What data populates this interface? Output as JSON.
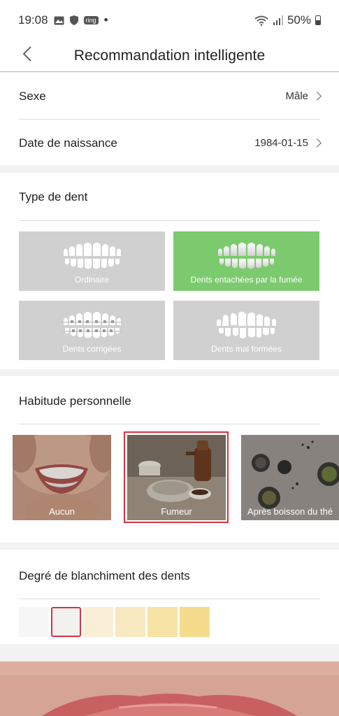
{
  "status_bar": {
    "time": "19:08",
    "ring_label": "ring",
    "dot": "•",
    "battery": "50%"
  },
  "header": {
    "title": "Recommandation intelligente"
  },
  "profile": {
    "sex_label": "Sexe",
    "sex_value": "Mâle",
    "birth_label": "Date de naissance",
    "birth_value": "1984-01-15"
  },
  "tooth_type": {
    "title": "Type de dent",
    "options": [
      {
        "label": "Ordinaire",
        "selected": false
      },
      {
        "label": "Dents entachées par la fumée",
        "selected": true
      },
      {
        "label": "Dents corrigées",
        "selected": false
      },
      {
        "label": "Dents mal formées",
        "selected": false
      }
    ]
  },
  "habit": {
    "title": "Habitude personnelle",
    "options": [
      {
        "label": "Aucun",
        "selected": false
      },
      {
        "label": "Fumeur",
        "selected": true
      },
      {
        "label": "Après boisson du thé",
        "selected": false
      }
    ]
  },
  "whitening": {
    "title": "Degré de blanchiment des dents",
    "selected_index": 1,
    "shades": [
      "#f7f7f7",
      "#f3f1ee",
      "#f8efd6",
      "#f8e9c0",
      "#f7e3a6",
      "#f5dc8c"
    ]
  },
  "colors": {
    "accent_green": "#7cca6e",
    "selection_red": "#d9323f",
    "tile_gray": "#d0d0d0"
  }
}
